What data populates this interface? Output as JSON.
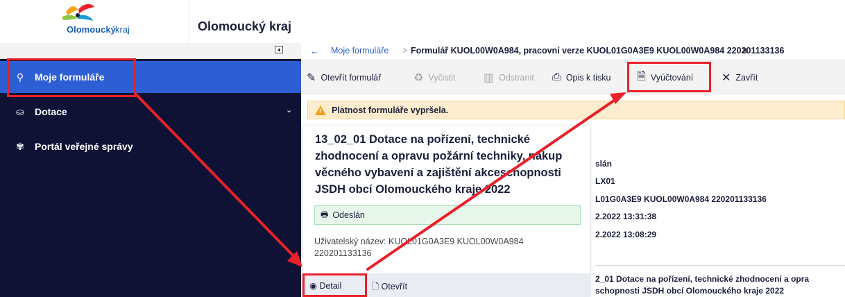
{
  "header": {
    "logo_text": "Olomoucký kraj",
    "app_title": "Olomoucký kraj"
  },
  "sidebar": {
    "items": [
      {
        "label": "Moje formuláře",
        "icon": "user-search-icon",
        "active": true
      },
      {
        "label": "Dotace",
        "icon": "money-hand-icon"
      },
      {
        "label": "Portál veřejné správy",
        "icon": "emblem-icon"
      }
    ],
    "dotace_chevron": "⌄"
  },
  "breadcrumb": {
    "back": "←",
    "link": "Moje formuláře",
    "separator": ">",
    "current": "Formulář KUOL00W0A984, pracovní verze KUOL01G0A3E9 KUOL00W0A984 220201133136",
    "close": "✕"
  },
  "toolbar": {
    "open": "Otevřít formulář",
    "clear": "Vyčistit",
    "delete": "Odstranit",
    "print": "Opis k tisku",
    "billing": "Vyúčtování",
    "close": "Zavřít"
  },
  "warning": {
    "text": "Platnost formuláře vypršela."
  },
  "card": {
    "title": "13_02_01 Dotace na pořízení, technické zhodnocení a opravu požární techniky, nákup věcného vybavení a zajištění akceschopnosti JSDH obcí Olomouckého kraje 2022",
    "status": "Odeslán",
    "user_label": "Uživatelský název: KUOL01G0A3E9 KUOL00W0A984 220201133136",
    "detail_button": "Detail",
    "open_button": "Otevřít"
  },
  "detail_pane": {
    "line1": "slán",
    "line2": "LX01",
    "line3": "L01G0A3E9 KUOL00W0A984 220201133136",
    "line4": "2.2022 13:31:38",
    "line5": "2.2022 13:08:29",
    "line6": "2_01 Dotace na pořízení, technické zhodnocení a opra",
    "line7": "schopnosti JSDH obcí Olomouckého kraje 2022"
  },
  "colors": {
    "sidebar_bg": "#0f1235",
    "active_item": "#2e5ed4",
    "annotation_red": "#e8212a",
    "warning_bg": "#fdeccd",
    "status_bg": "#e6f6ea"
  }
}
